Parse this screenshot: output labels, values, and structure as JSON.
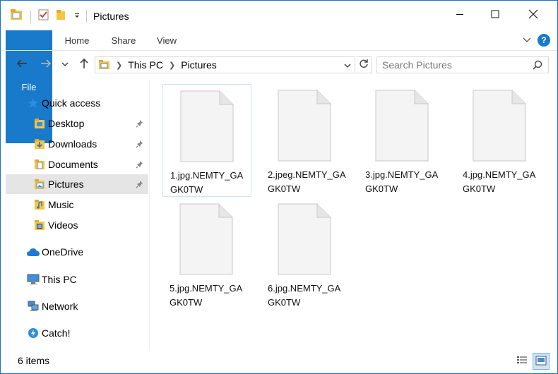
{
  "window": {
    "title": "Pictures",
    "accent": "#1979ca"
  },
  "ribbon": {
    "tabs": [
      {
        "label": "File"
      },
      {
        "label": "Home"
      },
      {
        "label": "Share"
      },
      {
        "label": "View"
      }
    ],
    "help_label": "?"
  },
  "navbar": {
    "breadcrumb": [
      "This PC",
      "Pictures"
    ],
    "search_placeholder": "Search Pictures"
  },
  "navpane": {
    "items": [
      {
        "label": "Quick access",
        "icon": "star-icon",
        "pinned": false
      },
      {
        "label": "Desktop",
        "icon": "folder-desktop-icon",
        "pinned": true
      },
      {
        "label": "Downloads",
        "icon": "folder-downloads-icon",
        "pinned": true
      },
      {
        "label": "Documents",
        "icon": "folder-documents-icon",
        "pinned": true
      },
      {
        "label": "Pictures",
        "icon": "folder-pictures-icon",
        "pinned": true,
        "selected": true
      },
      {
        "label": "Music",
        "icon": "folder-music-icon",
        "pinned": false
      },
      {
        "label": "Videos",
        "icon": "folder-videos-icon",
        "pinned": false
      },
      {
        "label": "OneDrive",
        "icon": "cloud-icon",
        "pinned": false
      },
      {
        "label": "This PC",
        "icon": "computer-icon",
        "pinned": false
      },
      {
        "label": "Network",
        "icon": "network-icon",
        "pinned": false
      },
      {
        "label": "Catch!",
        "icon": "catch-icon",
        "pinned": false
      }
    ]
  },
  "files": [
    {
      "name": "1.jpg.NEMTY_GAGK0TW",
      "selected": true
    },
    {
      "name": "2.jpeg.NEMTY_GAGK0TW",
      "selected": false
    },
    {
      "name": "3.jpg.NEMTY_GAGK0TW",
      "selected": false
    },
    {
      "name": "4.jpg.NEMTY_GAGK0TW",
      "selected": false
    },
    {
      "name": "5.jpg.NEMTY_GAGK0TW",
      "selected": false
    },
    {
      "name": "6.jpg.NEMTY_GAGK0TW",
      "selected": false
    }
  ],
  "status": {
    "item_count": "6 items"
  }
}
